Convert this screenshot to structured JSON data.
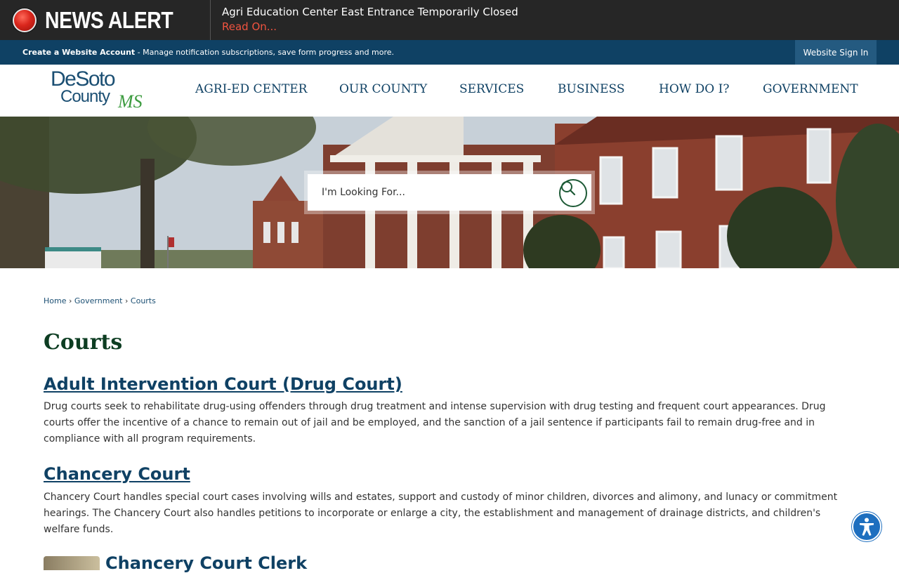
{
  "alert": {
    "label": "NEWS ALERT",
    "headline": "Agri Education Center East Entrance Temporarily Closed",
    "link": "Read On..."
  },
  "account": {
    "create_label": "Create a Website Account",
    "create_desc": " - Manage notification subscriptions, save form progress and more.",
    "signin_label": "Website Sign In"
  },
  "logo": {
    "line1": "DeSoto",
    "line2": "County",
    "suffix": "MS"
  },
  "nav": {
    "items": [
      {
        "label": "AGRI-ED CENTER"
      },
      {
        "label": "OUR COUNTY"
      },
      {
        "label": "SERVICES"
      },
      {
        "label": "BUSINESS"
      },
      {
        "label": "HOW DO I?"
      },
      {
        "label": "GOVERNMENT"
      }
    ]
  },
  "search": {
    "placeholder": "I'm Looking For..."
  },
  "breadcrumb": {
    "home": "Home",
    "government": "Government",
    "current": "Courts",
    "sep": "›"
  },
  "page": {
    "title": "Courts"
  },
  "courts": [
    {
      "title": "Adult Intervention Court (Drug Court)",
      "description": "Drug courts seek to rehabilitate drug-using offenders through drug treatment and intense supervision with drug testing and frequent court appearances. Drug courts offer the incentive of a chance to remain out of jail and be employed, and the sanction of a jail sentence if participants fail to remain drug-free and in compliance with all program requirements."
    },
    {
      "title": "Chancery Court",
      "description": "Chancery Court handles special court cases involving wills and estates, support and custody of minor children, divorces and alimony, and lunacy or commitment hearings. The Chancery Court also handles petitions to incorporate or enlarge a city, the establishment and management of drainage districts, and children's welfare funds."
    },
    {
      "title": "Chancery Court Clerk"
    }
  ],
  "colors": {
    "alert_bg": "#262626",
    "alert_link": "#f0533f",
    "account_bg": "#0f4164",
    "nav_text": "#0f4164",
    "title_green": "#0d3d22",
    "accessibility_blue": "#1e6fbf"
  },
  "icons": {
    "alert": "red-alert-dot-icon",
    "search": "search-icon",
    "accessibility": "accessibility-icon"
  }
}
